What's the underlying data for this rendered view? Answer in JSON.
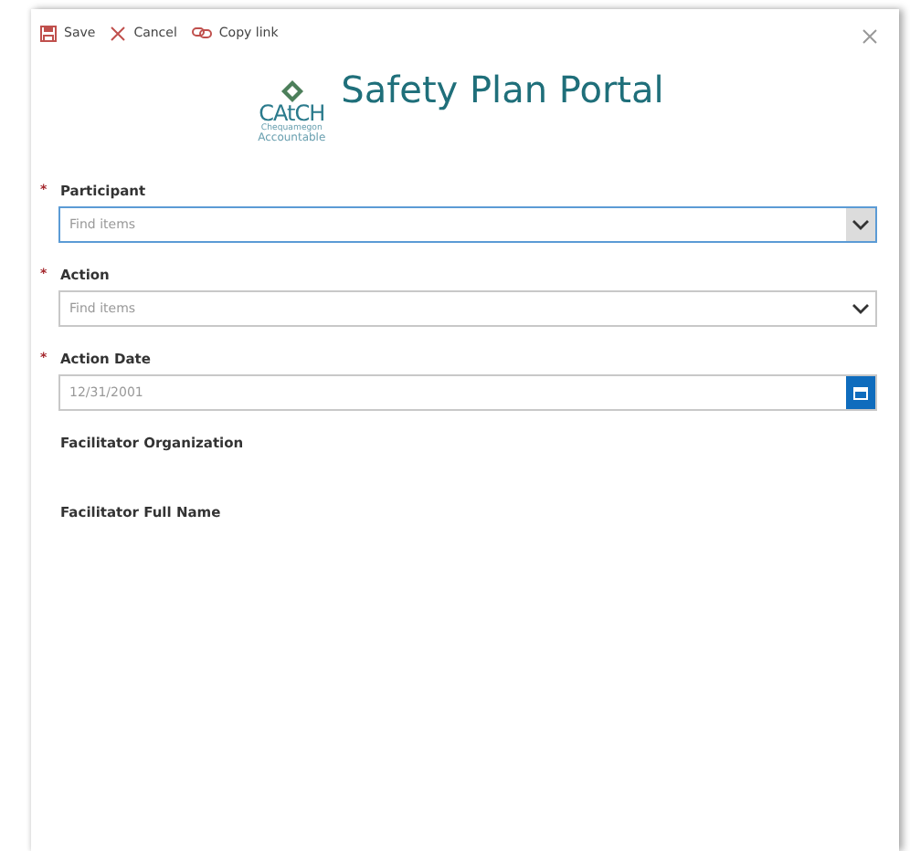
{
  "toolbar": {
    "actions": [
      {
        "kind": "save",
        "label": "Save"
      },
      {
        "kind": "cancel",
        "label": "Cancel"
      },
      {
        "kind": "link",
        "label": "Copy link"
      }
    ]
  },
  "header": {
    "logo": {
      "name": "CAtCH",
      "line_1": "Chequamegon",
      "line_2": "Accountable"
    },
    "title": "Safety Plan Portal"
  },
  "fields": [
    {
      "kind": "lookup",
      "marker": "*",
      "label": "Participant",
      "focused": true,
      "placeholder": "Find items"
    },
    {
      "kind": "lookup",
      "marker": "*",
      "label": "Action",
      "focused": false,
      "placeholder": "Find items"
    },
    {
      "kind": "date",
      "marker": "*",
      "label": "Action Date",
      "focused": false,
      "placeholder": "12/31/2001"
    },
    {
      "kind": "text",
      "label": "Facilitator Organization"
    },
    {
      "kind": "text",
      "label": "Facilitator Full Name"
    }
  ]
}
